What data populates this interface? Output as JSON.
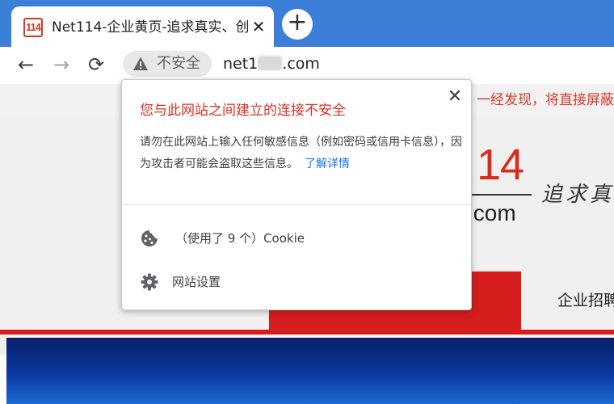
{
  "tab": {
    "favicon_text": "114",
    "title": "Net114-企业黄页-追求真实、创",
    "close_label": "✕",
    "new_tab_label": "+"
  },
  "toolbar": {
    "back_label": "←",
    "forward_label": "→",
    "reload_label": "⟳",
    "security_label": "不安全",
    "url_prefix": "net1",
    "url_suffix": ".com"
  },
  "page": {
    "notice_text": "一经发现，将直接屏蔽企",
    "logo_number": "14",
    "logo_domain": ".com",
    "logo_slogan": "追求真",
    "nav_item": "企业招聘"
  },
  "popup": {
    "close_label": "✕",
    "title": "您与此网站之间建立的连接不安全",
    "body": "请勿在此网站上输入任何敏感信息（例如密码或信用卡信息），因为攻击者可能会盗取这些信息。",
    "learn_more": "了解详情",
    "cookie_label": "（使用了 9 个）Cookie",
    "site_settings_label": "网站设置"
  },
  "colors": {
    "tabstrip": "#3c7fd9",
    "warning_red": "#d93025",
    "link_blue": "#1a73e8",
    "brand_red": "#d61d1d"
  },
  "icons": {
    "favicon": "net114-favicon",
    "warning": "warning-triangle-icon",
    "cookie": "cookie-icon",
    "settings": "gear-icon"
  }
}
